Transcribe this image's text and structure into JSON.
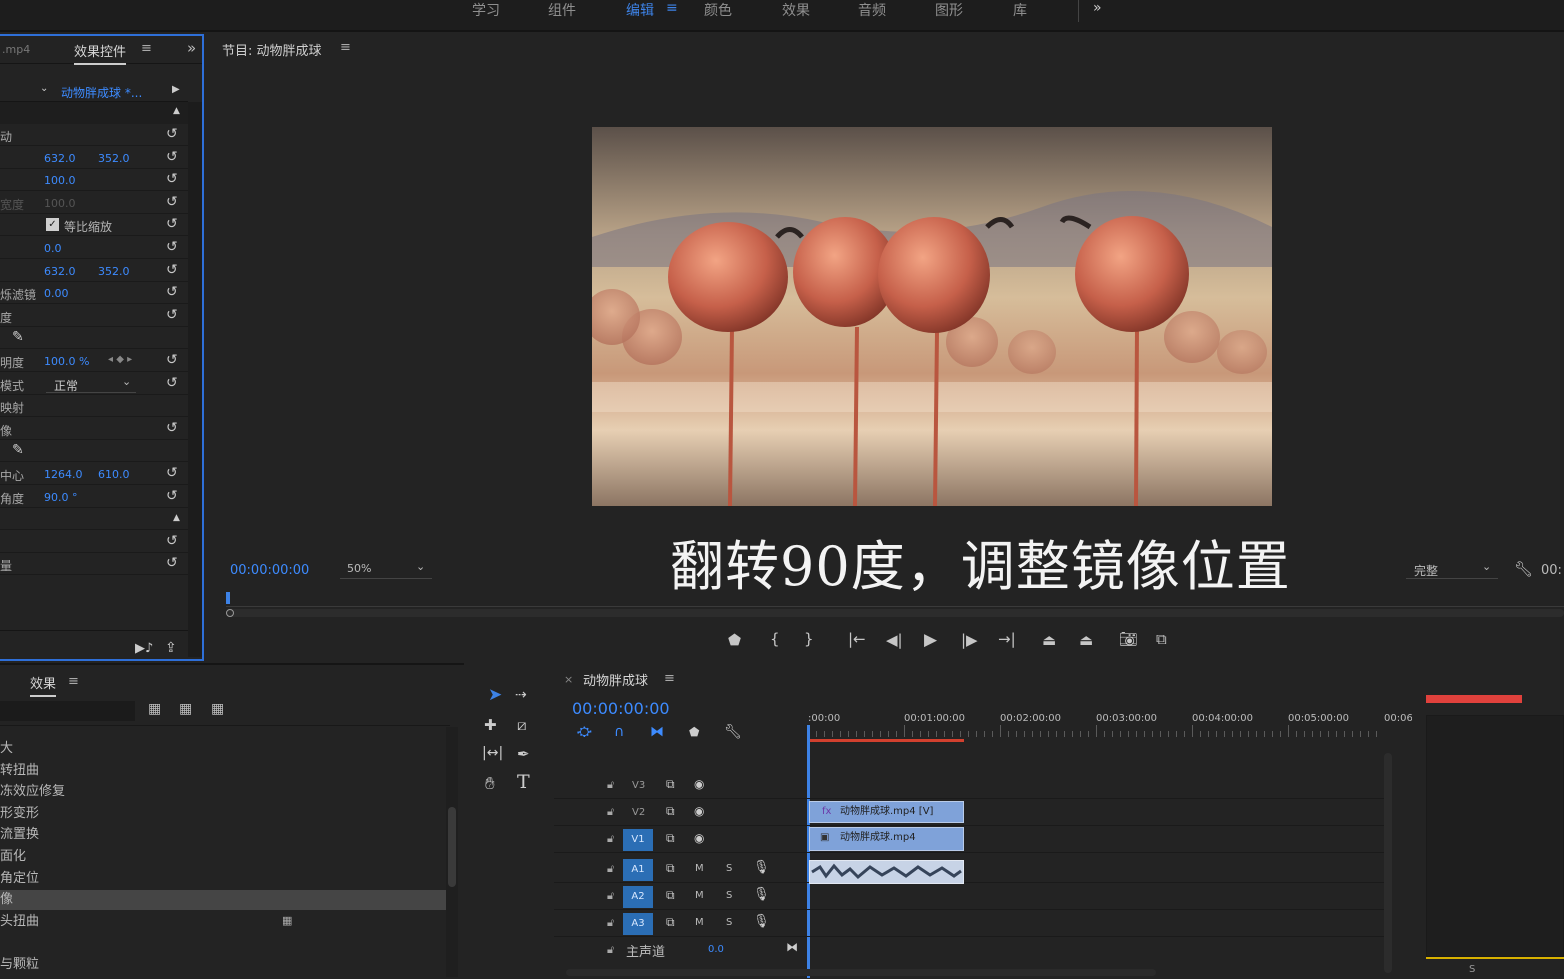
{
  "workspaces": [
    "学习",
    "组件",
    "编辑",
    "颜色",
    "效果",
    "音频",
    "图形",
    "库"
  ],
  "workspace_active_index": 2,
  "effect_controls": {
    "tab_prev": ".mp4",
    "tab_title": "效果控件",
    "clip_name": "动物胖成球 *...",
    "rows": [
      {
        "label": "动",
        "v1": "",
        "v2": ""
      },
      {
        "label": "",
        "v1": "632.0",
        "v2": "352.0"
      },
      {
        "label": "",
        "v1": "100.0",
        "v2": ""
      },
      {
        "label": "宽度",
        "v1": "100.0",
        "v2": ""
      },
      {
        "label": "",
        "v1": "等比缩放",
        "v2": ""
      },
      {
        "label": "",
        "v1": "0.0",
        "v2": ""
      },
      {
        "label": "",
        "v1": "632.0",
        "v2": "352.0"
      },
      {
        "label": "烁滤镜",
        "v1": "0.00",
        "v2": ""
      },
      {
        "label": "度",
        "v1": "",
        "v2": ""
      },
      {
        "label": "",
        "v1": "",
        "v2": ""
      },
      {
        "label": "明度",
        "v1": "100.0 %",
        "v2": ""
      },
      {
        "label": "模式",
        "v1": "正常",
        "v2": ""
      },
      {
        "label": "映射",
        "v1": "",
        "v2": ""
      },
      {
        "label": "像",
        "v1": "",
        "v2": ""
      },
      {
        "label": "",
        "v1": "",
        "v2": ""
      },
      {
        "label": "中心",
        "v1": "1264.0",
        "v2": "610.0"
      },
      {
        "label": "角度",
        "v1": "90.0 °",
        "v2": ""
      },
      {
        "label": "",
        "v1": "",
        "v2": ""
      },
      {
        "label": "",
        "v1": "",
        "v2": ""
      },
      {
        "label": "量",
        "v1": "",
        "v2": ""
      }
    ]
  },
  "program": {
    "title": "节目: 动物胖成球",
    "timecode": "00:00:00:00",
    "zoom": "50%",
    "quality": "完整",
    "timecode_right": "00:",
    "subtitle": "翻转90度，调整镜像位置"
  },
  "effects_panel": {
    "title": "效果",
    "items": [
      "大",
      "转扭曲",
      "冻效应修复",
      "形变形",
      "流置换",
      "面化",
      "角定位",
      "像",
      "头扭曲",
      "",
      "与颗粒"
    ],
    "selected_index": 7
  },
  "timeline": {
    "title": "动物胖成球",
    "timecode": "00:00:00:00",
    "ruler": [
      ":00:00",
      "00:01:00:00",
      "00:02:00:00",
      "00:03:00:00",
      "00:04:00:00",
      "00:05:00:00",
      "00:06"
    ],
    "video_tracks": [
      "V3",
      "V2",
      "V1"
    ],
    "audio_tracks": [
      "A1",
      "A2",
      "A3"
    ],
    "master_label": "主声道",
    "master_value": "0.0",
    "clip_v2": "动物胖成球.mp4 [V]",
    "clip_v1": "动物胖成球.mp4",
    "audio_m": "M",
    "audio_s": "S"
  },
  "meter": {
    "label": "S"
  },
  "colors": {
    "accent": "#3d82e6",
    "panel": "#232323",
    "timeline_playhead": "#3d82e6",
    "clip": "#7fa2d9"
  }
}
